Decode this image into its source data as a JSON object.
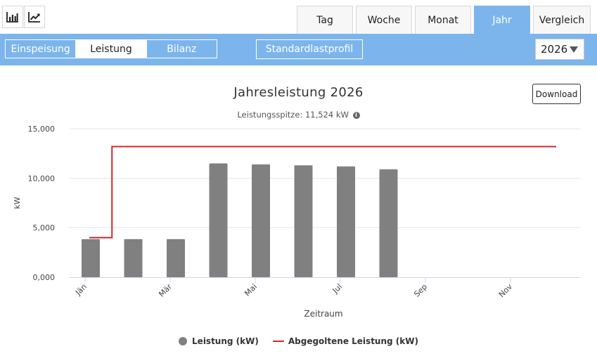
{
  "toolbar_icons": {
    "bar_chart": "bar-chart-icon",
    "line_chart": "line-chart-icon"
  },
  "period_tabs": [
    {
      "label": "Tag",
      "active": false
    },
    {
      "label": "Woche",
      "active": false
    },
    {
      "label": "Monat",
      "active": false
    },
    {
      "label": "Jahr",
      "active": true
    },
    {
      "label": "Vergleich",
      "active": false
    }
  ],
  "mode_tabs": [
    {
      "label": "Einspeisung",
      "active": false
    },
    {
      "label": "Leistung",
      "active": true
    },
    {
      "label": "Bilanz",
      "active": false
    }
  ],
  "profile_button": "Standardlastprofil",
  "year_select": {
    "value": "2026"
  },
  "download_label": "Download",
  "colors": {
    "accent": "#7cb5ec",
    "bar": "#808080",
    "line": "#d62728"
  },
  "chart_data": {
    "type": "bar",
    "title": "Jahresleistung 2026",
    "subtitle": "Leistungsspitze: 11,524 kW",
    "xlabel": "Zeitraum",
    "ylabel": "kW",
    "ylim": [
      0,
      15000
    ],
    "yticks": [
      {
        "value": 0,
        "label": "0,000"
      },
      {
        "value": 5000,
        "label": "5,000"
      },
      {
        "value": 10000,
        "label": "10,000"
      },
      {
        "value": 15000,
        "label": "15,000"
      }
    ],
    "grid": true,
    "months": 12,
    "xtick_labels": [
      {
        "index": 0,
        "label": "Jän"
      },
      {
        "index": 2,
        "label": "Mär"
      },
      {
        "index": 4,
        "label": "Mai"
      },
      {
        "index": 6,
        "label": "Jul"
      },
      {
        "index": 8,
        "label": "Sep"
      },
      {
        "index": 10,
        "label": "Nov"
      }
    ],
    "series": [
      {
        "name": "Leistung (kW)",
        "type": "bar",
        "values": [
          3850,
          3850,
          3850,
          11500,
          11400,
          11300,
          11200,
          10900,
          null,
          null,
          null,
          null
        ]
      },
      {
        "name": "Abgegoltene Leistung (kW)",
        "type": "step-line",
        "values": [
          4000,
          13200,
          13200,
          13200,
          13200,
          13200,
          13200,
          13200,
          13200,
          13200,
          13200,
          13200
        ]
      }
    ],
    "legend": "bottom-center"
  }
}
